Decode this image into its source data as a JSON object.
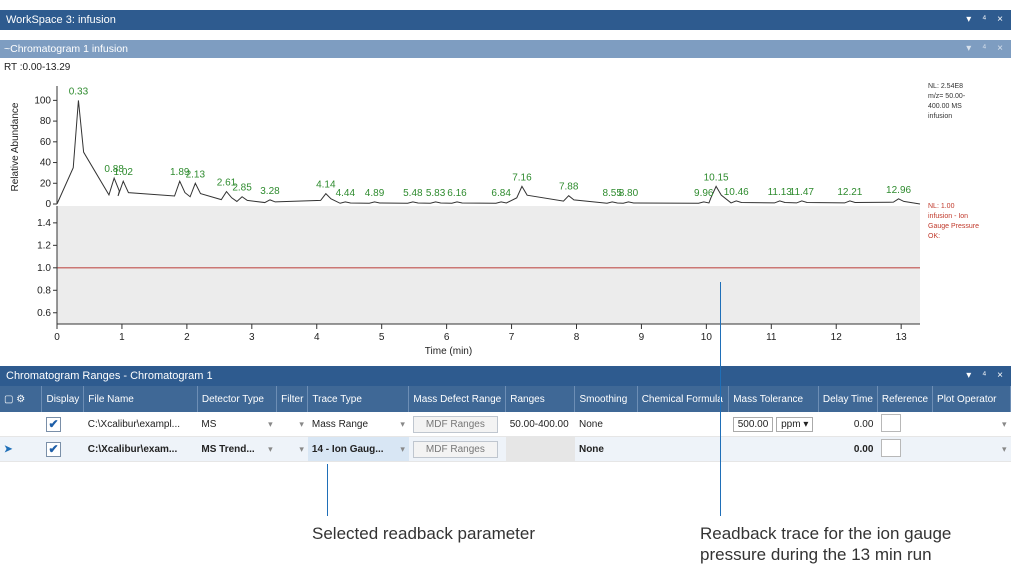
{
  "workspace": {
    "title": "WorkSpace 3: infusion",
    "controls": "▾ ⁴ ×"
  },
  "chrom_panel": {
    "title": "~Chromatogram  1  infusion",
    "controls": "▾ ⁴ ×"
  },
  "chart_data": {
    "type": "line",
    "rt_label": "RT :0.00-13.29",
    "xlabel": "Time (min)",
    "ylabel": "Relative Abundance",
    "xlim": [
      0,
      13.29
    ],
    "x_ticks": [
      "0",
      "1",
      "2",
      "3",
      "4",
      "5",
      "6",
      "7",
      "8",
      "9",
      "10",
      "11",
      "12",
      "13"
    ],
    "top": {
      "ylim": [
        0,
        110
      ],
      "y_ticks": [
        "0",
        "20",
        "40",
        "60",
        "80",
        "100"
      ],
      "peaks": [
        {
          "x": 0.33,
          "y": 100
        },
        {
          "x": 0.88,
          "y": 25
        },
        {
          "x": 1.02,
          "y": 22
        },
        {
          "x": 1.89,
          "y": 22
        },
        {
          "x": 2.13,
          "y": 20
        },
        {
          "x": 2.61,
          "y": 12
        },
        {
          "x": 2.85,
          "y": 7
        },
        {
          "x": 3.28,
          "y": 4
        },
        {
          "x": 4.14,
          "y": 10
        },
        {
          "x": 4.44,
          "y": 2
        },
        {
          "x": 4.89,
          "y": 2
        },
        {
          "x": 5.48,
          "y": 2
        },
        {
          "x": 5.83,
          "y": 2
        },
        {
          "x": 6.16,
          "y": 2
        },
        {
          "x": 6.84,
          "y": 2
        },
        {
          "x": 7.16,
          "y": 17
        },
        {
          "x": 7.88,
          "y": 8
        },
        {
          "x": 8.55,
          "y": 2
        },
        {
          "x": 8.8,
          "y": 2
        },
        {
          "x": 9.96,
          "y": 2
        },
        {
          "x": 10.15,
          "y": 17
        },
        {
          "x": 10.46,
          "y": 3
        },
        {
          "x": 11.13,
          "y": 3
        },
        {
          "x": 11.47,
          "y": 3
        },
        {
          "x": 12.21,
          "y": 3
        },
        {
          "x": 12.96,
          "y": 5
        }
      ],
      "peak_labels": [
        "0.33",
        "0.88",
        "1.02",
        "1.89",
        "2.13",
        "2.61",
        "2.85",
        "3.28",
        "4.14",
        "4.44",
        "4.89",
        "5.48",
        "5.83",
        "6.16",
        "6.84",
        "7.16",
        "7.88",
        "8.55",
        "8.80",
        "9.96",
        "10.15",
        "10.46",
        "11.13",
        "11.47",
        "12.21",
        "12.96"
      ],
      "info": [
        "NL: 2.54E8",
        "m/z= 50.00-",
        "400.00 MS",
        "infusion"
      ]
    },
    "bottom": {
      "ylim": [
        0.5,
        1.55
      ],
      "y_ticks": [
        "0.6",
        "0.8",
        "1.0",
        "1.2",
        "1.4"
      ],
      "constant": 1.0,
      "info": [
        "NL: 1.00",
        "infusion - Ion",
        "Gauge Pressure",
        "OK:"
      ]
    },
    "colors": {
      "trace": "#333333",
      "label": "#2e8b2e",
      "readback": "#c0504d",
      "info_red": "#c0392b"
    }
  },
  "ranges_panel": {
    "title": "Chromatogram Ranges - Chromatogram 1",
    "controls": "▾ ⁴ ×",
    "columns": [
      "Display",
      "File Name",
      "Detector Type",
      "Filter",
      "Trace Type",
      "Mass Defect Range",
      "Ranges",
      "Smoothing",
      "Chemical Formula",
      "Mass Tolerance",
      "Delay Time",
      "Reference",
      "Plot Operator"
    ],
    "rows": [
      {
        "marker": "",
        "display": "✔",
        "file": "C:\\Xcalibur\\exampl...",
        "detector": "MS",
        "trace": "Mass Range",
        "mdf": "MDF Ranges",
        "ranges": "50.00-400.00",
        "smoothing": "None",
        "tol_value": "500.00",
        "tol_unit": "ppm",
        "delay": "0.00"
      },
      {
        "marker": "➤",
        "display": "✔",
        "file": "C:\\Xcalibur\\exam...",
        "detector": "MS Trend...",
        "trace": "14 - Ion Gaug...",
        "mdf": "MDF Ranges",
        "ranges": "",
        "smoothing": "None",
        "tol_value": "",
        "tol_unit": "",
        "delay": "0.00"
      }
    ]
  },
  "callouts": {
    "selected": "Selected readback parameter",
    "readback_line1": "Readback trace for the ion gauge",
    "readback_line2": "pressure during the 13 min run"
  }
}
